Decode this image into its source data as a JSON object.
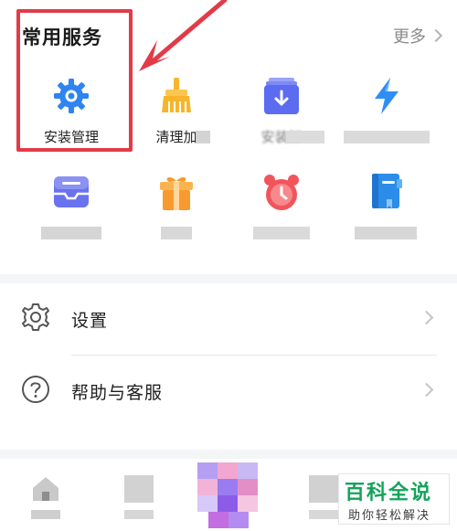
{
  "services": {
    "title": "常用服务",
    "more_label": "更多",
    "items": [
      {
        "label": "安装管理",
        "icon": "gear-icon",
        "color": "#2f84f2"
      },
      {
        "label": "清理加",
        "icon": "broom-icon",
        "color": "#f6b52b"
      },
      {
        "label": "安装卸",
        "icon": "download-box-icon",
        "color": "#5b6cf0"
      },
      {
        "label": "",
        "icon": "lightning-icon",
        "color": "#2f8ef5"
      },
      {
        "label": "",
        "icon": "inbox-icon",
        "color": "#6a72ee"
      },
      {
        "label": "",
        "icon": "gift-icon",
        "color": "#f89a2d"
      },
      {
        "label": "",
        "icon": "alarm-clock-icon",
        "color": "#f2545b"
      },
      {
        "label": "",
        "icon": "book-icon",
        "color": "#2c8ce9"
      }
    ]
  },
  "menu": {
    "items": [
      {
        "label": "设置",
        "icon": "gear-outline-icon"
      },
      {
        "label": "帮助与客服",
        "icon": "question-circle-icon"
      }
    ]
  },
  "tabbar": {
    "items": [
      {
        "icon": "home-icon"
      },
      {
        "icon": "tab-icon"
      },
      {
        "icon": "center-app-icon"
      },
      {
        "icon": "tab-icon"
      },
      {
        "icon": "profile-icon"
      }
    ]
  },
  "watermark": {
    "title": "百科全说",
    "subtitle": "助你轻松解决"
  },
  "colors": {
    "highlight": "#e23b48",
    "accent_blue": "#2f84f2",
    "watermark_green": "#13a35b"
  }
}
